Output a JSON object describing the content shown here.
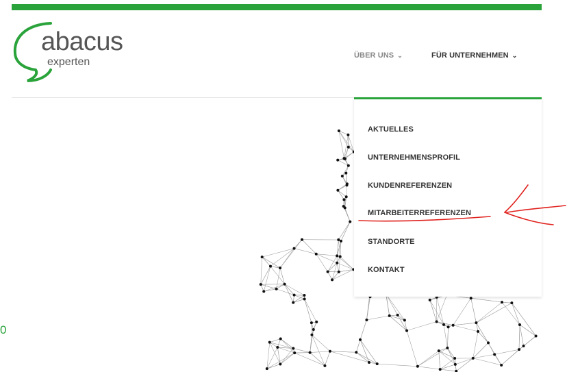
{
  "logo": {
    "main": "abacus",
    "sub": "experten"
  },
  "nav": {
    "items": [
      {
        "label": "ÜBER UNS",
        "chevron": "⌄"
      },
      {
        "label": "FÜR UNTERNEHMEN",
        "chevron": "⌄"
      }
    ]
  },
  "dropdown": {
    "items": [
      "AKTUELLES",
      "UNTERNEHMENSPROFIL",
      "KUNDENREFERENZEN",
      "MITARBEITERREFERENZEN",
      "STANDORTE",
      "KONTAKT"
    ]
  },
  "corner_text": "0",
  "colors": {
    "accent": "#2aa33b",
    "annotation": "#e0201c"
  }
}
